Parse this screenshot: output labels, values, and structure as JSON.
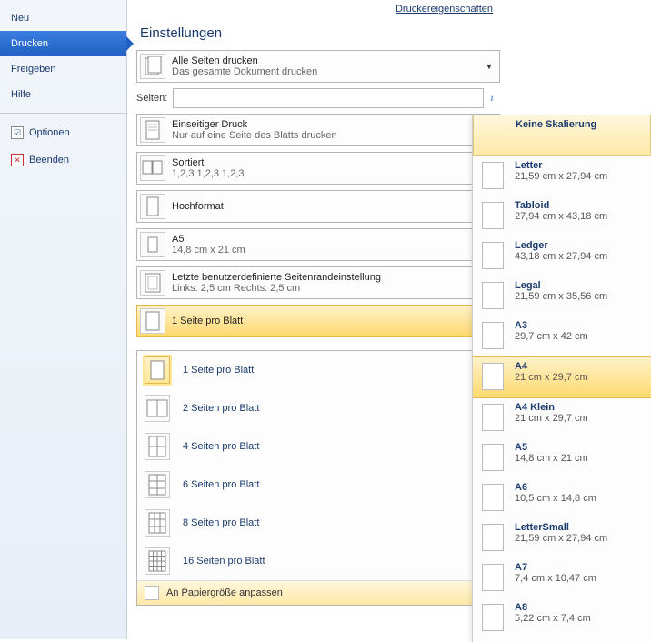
{
  "header": {
    "printer_properties": "Druckereigenschaften"
  },
  "sidebar": {
    "items": [
      {
        "label": "Neu"
      },
      {
        "label": "Drucken"
      },
      {
        "label": "Freigeben"
      },
      {
        "label": "Hilfe"
      },
      {
        "label": "Optionen"
      },
      {
        "label": "Beenden"
      }
    ]
  },
  "settings": {
    "title": "Einstellungen",
    "pages_label": "Seiten:",
    "pages_value": "",
    "dropdowns": [
      {
        "title": "Alle Seiten drucken",
        "sub": "Das gesamte Dokument drucken"
      },
      {
        "title": "Einseitiger Druck",
        "sub": "Nur auf eine Seite des Blatts drucken"
      },
      {
        "title": "Sortiert",
        "sub": "1,2,3   1,2,3   1,2,3"
      },
      {
        "title": "Hochformat",
        "sub": ""
      },
      {
        "title": "A5",
        "sub": "14,8  cm x 21  cm"
      },
      {
        "title": "Letzte benutzerdefinierte Seitenrandeinstellung",
        "sub": "Links: 2,5  cm   Rechts: 2,5  cm"
      },
      {
        "title": "1 Seite pro Blatt",
        "sub": ""
      }
    ]
  },
  "pages_menu": {
    "items": [
      {
        "label": "1 Seite pro Blatt"
      },
      {
        "label": "2 Seiten pro Blatt"
      },
      {
        "label": "4 Seiten pro Blatt"
      },
      {
        "label": "6 Seiten pro Blatt"
      },
      {
        "label": "8 Seiten pro Blatt"
      },
      {
        "label": "16 Seiten pro Blatt"
      }
    ],
    "footer": "An Papiergröße anpassen"
  },
  "paper_sizes": {
    "items": [
      {
        "title": "Keine Skalierung",
        "sub": "",
        "none": true
      },
      {
        "title": "Letter",
        "sub": "21,59  cm x 27,94  cm"
      },
      {
        "title": "Tabloid",
        "sub": "27,94  cm x 43,18  cm"
      },
      {
        "title": "Ledger",
        "sub": "43,18  cm x 27,94  cm"
      },
      {
        "title": "Legal",
        "sub": "21,59  cm x 35,56  cm"
      },
      {
        "title": "A3",
        "sub": "29,7  cm x 42  cm"
      },
      {
        "title": "A4",
        "sub": "21  cm x 29,7  cm"
      },
      {
        "title": "A4 Klein",
        "sub": "21  cm x 29,7  cm"
      },
      {
        "title": "A5",
        "sub": "14,8  cm x 21  cm"
      },
      {
        "title": "A6",
        "sub": "10,5  cm x 14,8  cm"
      },
      {
        "title": "LetterSmall",
        "sub": "21,59  cm x 27,94  cm"
      },
      {
        "title": "A7",
        "sub": "7,4  cm x 10,47  cm"
      },
      {
        "title": "A8",
        "sub": "5,22  cm x 7,4  cm"
      }
    ],
    "selected_index": 6
  }
}
